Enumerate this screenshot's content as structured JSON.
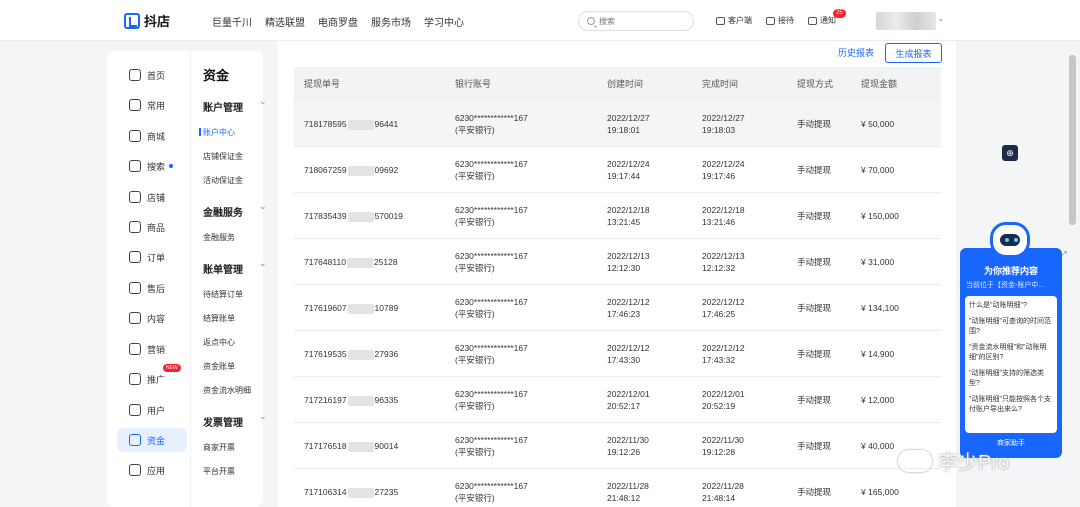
{
  "header": {
    "logo_text": "抖店",
    "nav": [
      "巨量千川",
      "精选联盟",
      "电商罗盘",
      "服务市场",
      "学习中心"
    ],
    "search_placeholder": "搜索",
    "tools": {
      "client": "客户端",
      "receive": "接待",
      "notify": "通知",
      "notify_badge": "25"
    }
  },
  "sidebar": {
    "primary": [
      "首页",
      "常用",
      "商城",
      "搜索",
      "店铺",
      "商品",
      "订单",
      "售后",
      "内容",
      "营销",
      "推广",
      "用户",
      "资金",
      "应用"
    ],
    "new_tag": "NEW",
    "section_title": "资金",
    "groups": [
      {
        "title": "账户管理",
        "items": [
          "账户中心",
          "店铺保证金",
          "活动保证金"
        ]
      },
      {
        "title": "金融服务",
        "items": [
          "金融服务"
        ]
      },
      {
        "title": "账单管理",
        "items": [
          "待结算订单",
          "结算账单",
          "返点中心",
          "资金账单",
          "资金流水明细"
        ]
      },
      {
        "title": "发票管理",
        "items": [
          "商家开票",
          "平台开票"
        ]
      }
    ]
  },
  "actions": {
    "history": "历史报表",
    "generate": "生成报表"
  },
  "table": {
    "columns": [
      "提现单号",
      "银行账号",
      "创建时间",
      "完成时间",
      "提现方式",
      "提现金额"
    ],
    "rows": [
      {
        "id_a": "718178595",
        "id_b": "96441",
        "bank": "6230************167",
        "bank_name": "(平安银行)",
        "c_date": "2022/12/27",
        "c_time": "19:18:01",
        "f_date": "2022/12/27",
        "f_time": "19:18:03",
        "method": "手动提现",
        "amount": "¥ 50,000"
      },
      {
        "id_a": "718067259",
        "id_b": "09692",
        "bank": "6230************167",
        "bank_name": "(平安银行)",
        "c_date": "2022/12/24",
        "c_time": "19:17:44",
        "f_date": "2022/12/24",
        "f_time": "19:17:46",
        "method": "手动提现",
        "amount": "¥ 70,000"
      },
      {
        "id_a": "717835439",
        "id_b": "570019",
        "bank": "6230************167",
        "bank_name": "(平安银行)",
        "c_date": "2022/12/18",
        "c_time": "13:21:45",
        "f_date": "2022/12/18",
        "f_time": "13:21:46",
        "method": "手动提现",
        "amount": "¥ 150,000"
      },
      {
        "id_a": "717648110",
        "id_b": "25128",
        "bank": "6230************167",
        "bank_name": "(平安银行)",
        "c_date": "2022/12/13",
        "c_time": "12:12:30",
        "f_date": "2022/12/13",
        "f_time": "12:12:32",
        "method": "手动提现",
        "amount": "¥ 31,000"
      },
      {
        "id_a": "717619607",
        "id_b": "10789",
        "bank": "6230************167",
        "bank_name": "(平安银行)",
        "c_date": "2022/12/12",
        "c_time": "17:46:23",
        "f_date": "2022/12/12",
        "f_time": "17:46:25",
        "method": "手动提现",
        "amount": "¥ 134,100"
      },
      {
        "id_a": "717619535",
        "id_b": "27936",
        "bank": "6230************167",
        "bank_name": "(平安银行)",
        "c_date": "2022/12/12",
        "c_time": "17:43:30",
        "f_date": "2022/12/12",
        "f_time": "17:43:32",
        "method": "手动提现",
        "amount": "¥ 14,900"
      },
      {
        "id_a": "717216197",
        "id_b": "96335",
        "bank": "6230************167",
        "bank_name": "(平安银行)",
        "c_date": "2022/12/01",
        "c_time": "20:52:17",
        "f_date": "2022/12/01",
        "f_time": "20:52:19",
        "method": "手动提现",
        "amount": "¥ 12,000"
      },
      {
        "id_a": "717176518",
        "id_b": "90014",
        "bank": "6230************167",
        "bank_name": "(平安银行)",
        "c_date": "2022/11/30",
        "c_time": "19:12:26",
        "f_date": "2022/11/30",
        "f_time": "19:12:28",
        "method": "手动提现",
        "amount": "¥ 40,000"
      },
      {
        "id_a": "717106314",
        "id_b": "27235",
        "bank": "6230************167",
        "bank_name": "(平安银行)",
        "c_date": "2022/11/28",
        "c_time": "21:48:12",
        "f_date": "2022/11/28",
        "f_time": "21:48:14",
        "method": "手动提现",
        "amount": "¥ 165,000"
      }
    ]
  },
  "assistant": {
    "title": "为你推荐内容",
    "subtitle": "当前位于【资金-账户中...",
    "questions": [
      "什么是\"动账明细\"?",
      "\"动账明细\"可查询的时间范围?",
      "\"资金流水明细\"和\"动账明细\"的区别?",
      "\"动账明细\"支持的筛选类型?",
      "\"动账明细\"只能按照各个支付账户导出来么?"
    ],
    "footer": "商家助手"
  },
  "watermark": "李少Pro"
}
